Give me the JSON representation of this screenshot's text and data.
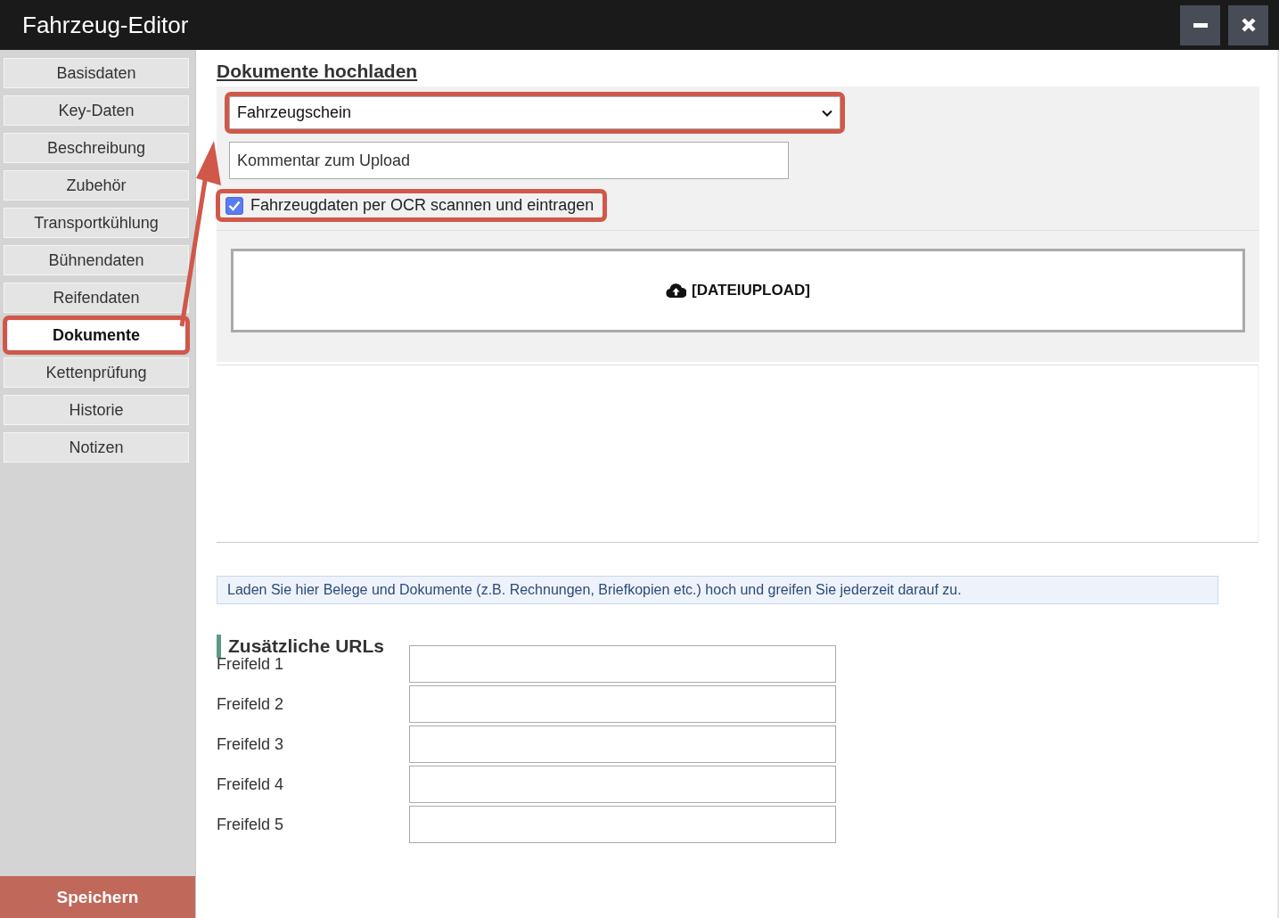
{
  "window": {
    "title": "Fahrzeug-Editor",
    "controls": [
      {
        "kind": "minimize"
      },
      {
        "kind": "close"
      }
    ]
  },
  "sidebar": {
    "items": [
      {
        "label": "Basisdaten",
        "selected": false,
        "highlighted": false
      },
      {
        "label": "Key-Daten",
        "selected": false,
        "highlighted": false
      },
      {
        "label": "Beschreibung",
        "selected": false,
        "highlighted": false
      },
      {
        "label": "Zubehör",
        "selected": false,
        "highlighted": false
      },
      {
        "label": "Transportkühlung",
        "selected": false,
        "highlighted": false
      },
      {
        "label": "Bühnendaten",
        "selected": false,
        "highlighted": false
      },
      {
        "label": "Reifendaten",
        "selected": false,
        "highlighted": false
      },
      {
        "label": "Dokumente",
        "selected": true,
        "highlighted": true
      },
      {
        "label": "Kettenprüfung",
        "selected": false,
        "highlighted": false
      },
      {
        "label": "Historie",
        "selected": false,
        "highlighted": false
      },
      {
        "label": "Notizen",
        "selected": false,
        "highlighted": false
      }
    ],
    "save_button": "Speichern"
  },
  "upload": {
    "heading": "Dokumente hochladen",
    "document_type": {
      "value": "Fahrzeugschein",
      "highlighted": true
    },
    "comment": {
      "placeholder": "Kommentar zum Upload"
    },
    "ocr_checkbox": {
      "label": "Fahrzeugdaten per OCR scannen und eintragen",
      "checked": true,
      "highlighted": true
    },
    "dropzone": "[DATEIUPLOAD]",
    "info": "Laden Sie hier Belege und Dokumente (z.B. Rechnungen, Briefkopien etc.) hoch und greifen Sie jederzeit darauf zu."
  },
  "urls": {
    "heading": "Zusätzliche URLs",
    "fields": [
      {
        "label": "Freifeld 1"
      },
      {
        "label": "Freifeld 2"
      },
      {
        "label": "Freifeld 3"
      },
      {
        "label": "Freifeld 4"
      },
      {
        "label": "Freifeld 5"
      }
    ]
  }
}
